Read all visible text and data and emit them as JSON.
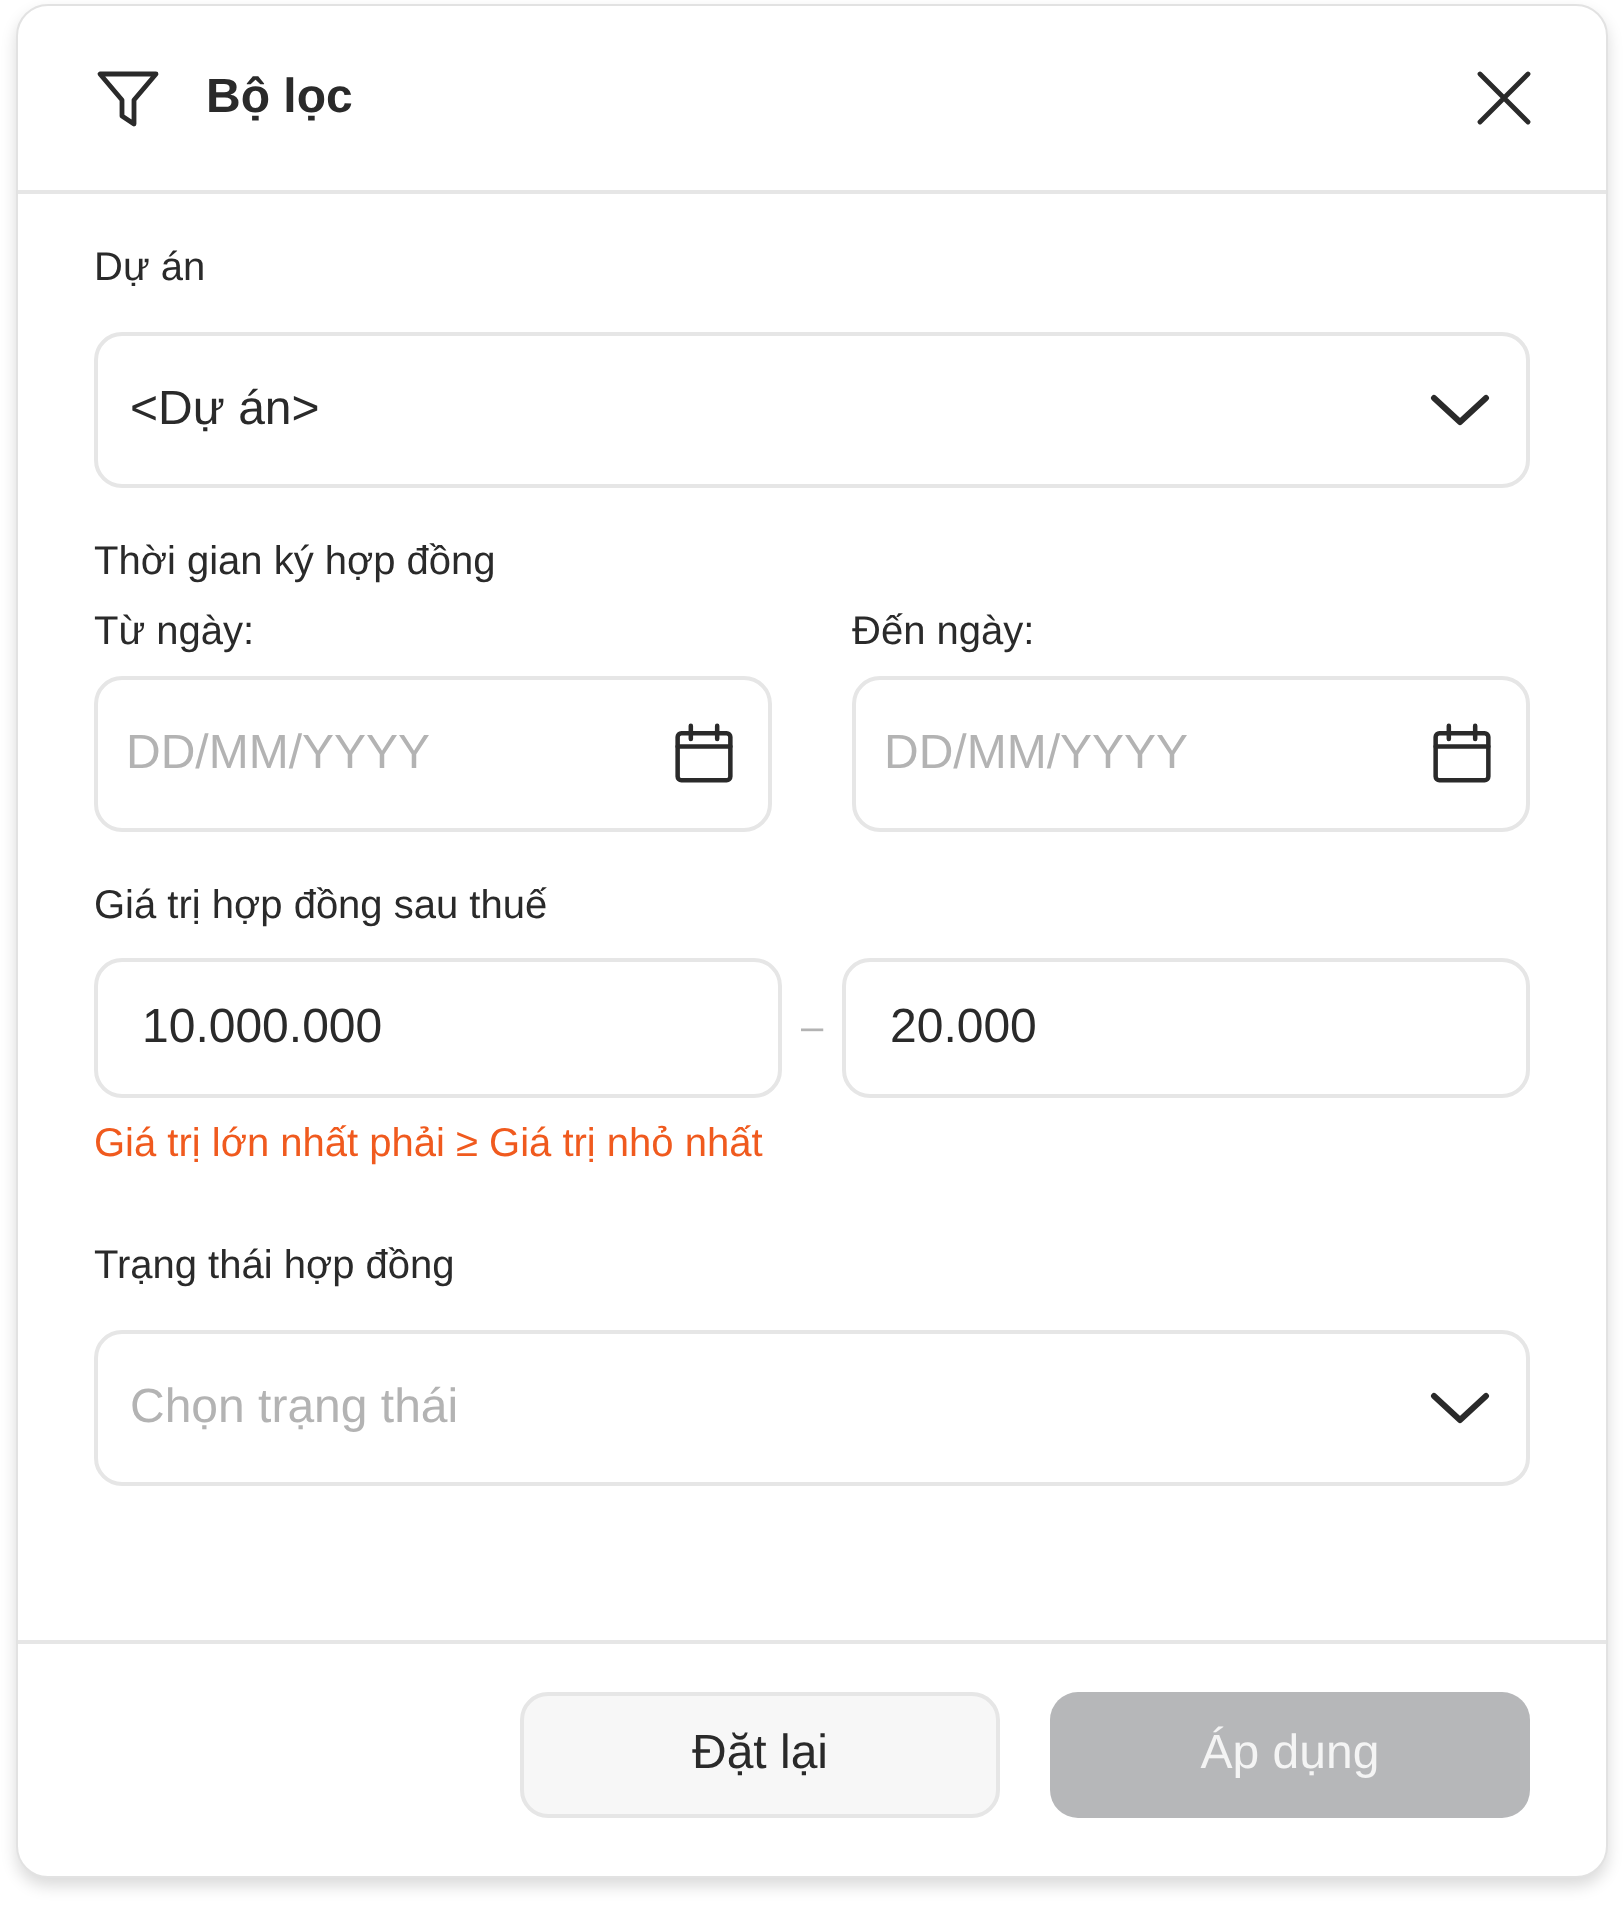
{
  "dialog": {
    "title": "Bộ lọc"
  },
  "project": {
    "label": "Dự án",
    "value": "<Dự án>"
  },
  "signing_period": {
    "label": "Thời gian ký hợp đồng",
    "from": {
      "label": "Từ ngày:",
      "placeholder": "DD/MM/YYYY"
    },
    "to": {
      "label": "Đến ngày:",
      "placeholder": "DD/MM/YYYY"
    }
  },
  "contract_value": {
    "label": "Giá trị hợp đồng sau thuế",
    "min": "10.000.000",
    "separator": "–",
    "max": "20.000",
    "error": "Giá trị lớn nhất phải ≥ Giá trị nhỏ nhất"
  },
  "status": {
    "label": "Trạng thái hợp đồng",
    "placeholder": "Chọn trạng thái"
  },
  "buttons": [
    {
      "label": "Đặt lại",
      "disabled": false
    },
    {
      "label": "Áp dụng",
      "disabled": true
    }
  ]
}
